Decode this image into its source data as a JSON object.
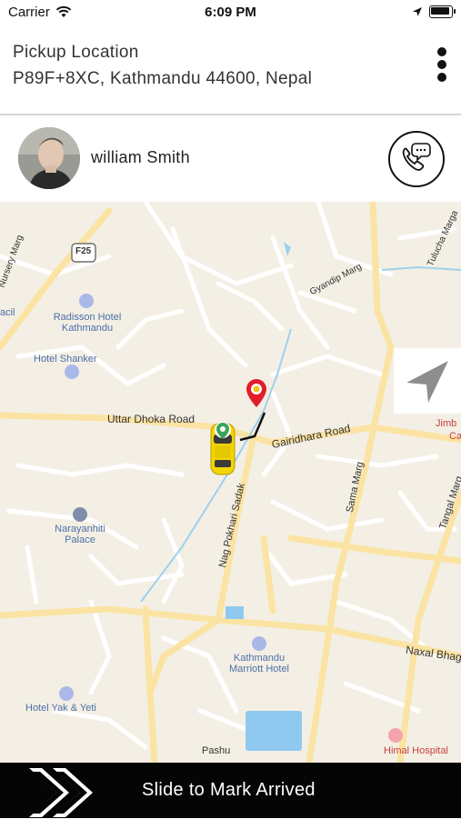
{
  "status_bar": {
    "carrier": "Carrier",
    "time": "6:09 PM",
    "wifi_icon": "wifi-icon",
    "location_icon": "location-arrow-icon",
    "battery_icon": "battery-icon"
  },
  "header": {
    "pickup_label": "Pickup Location",
    "pickup_address": "P89F+8XC, Kathmandu 44600, Nepal",
    "menu_icon": "more-vertical-icon"
  },
  "driver": {
    "name": "william Smith",
    "call_icon": "phone-chat-icon"
  },
  "map": {
    "roads": {
      "f25": "F25",
      "nursery": "Nursery Marg",
      "gyandip": "Gyandip Marg",
      "tulucha": "Tulucha Marga",
      "uttar_dhoka": "Uttar Dhoka Road",
      "gairidhara": "Gairidhara Road",
      "nag_pokhari": "Nag Pokhari Sadak",
      "sama": "Sama Marg",
      "tangal": "Tangal Marg",
      "naxal": "Naxal Bhag",
      "pashu": "Pashu"
    },
    "places": {
      "acil": "acil",
      "radisson": "Radisson Hotel Kathmandu",
      "shanker": "Hotel Shanker",
      "narayanhiti": "Narayanhiti Palace",
      "marriott": "Kathmandu Marriott Hotel",
      "yak_yeti": "Hotel Yak & Yeti",
      "himal": "Himal Hospital",
      "jimb": "Jimb",
      "ca": "Ca"
    },
    "pickup_pin_icon": "map-pin-icon",
    "car_icon": "taxi-car-icon",
    "locate_icon": "navigation-arrow-icon",
    "colors": {
      "map_bg": "#f4efe4",
      "road": "#ffffff",
      "major_road": "#fbe3a3",
      "route": "#111111",
      "pin": "#e21d2b",
      "car": "#f2d400"
    }
  },
  "bottom_bar": {
    "slide_label": "Slide to Mark Arrived",
    "arrows_icon": "double-chevron-right-icon"
  }
}
